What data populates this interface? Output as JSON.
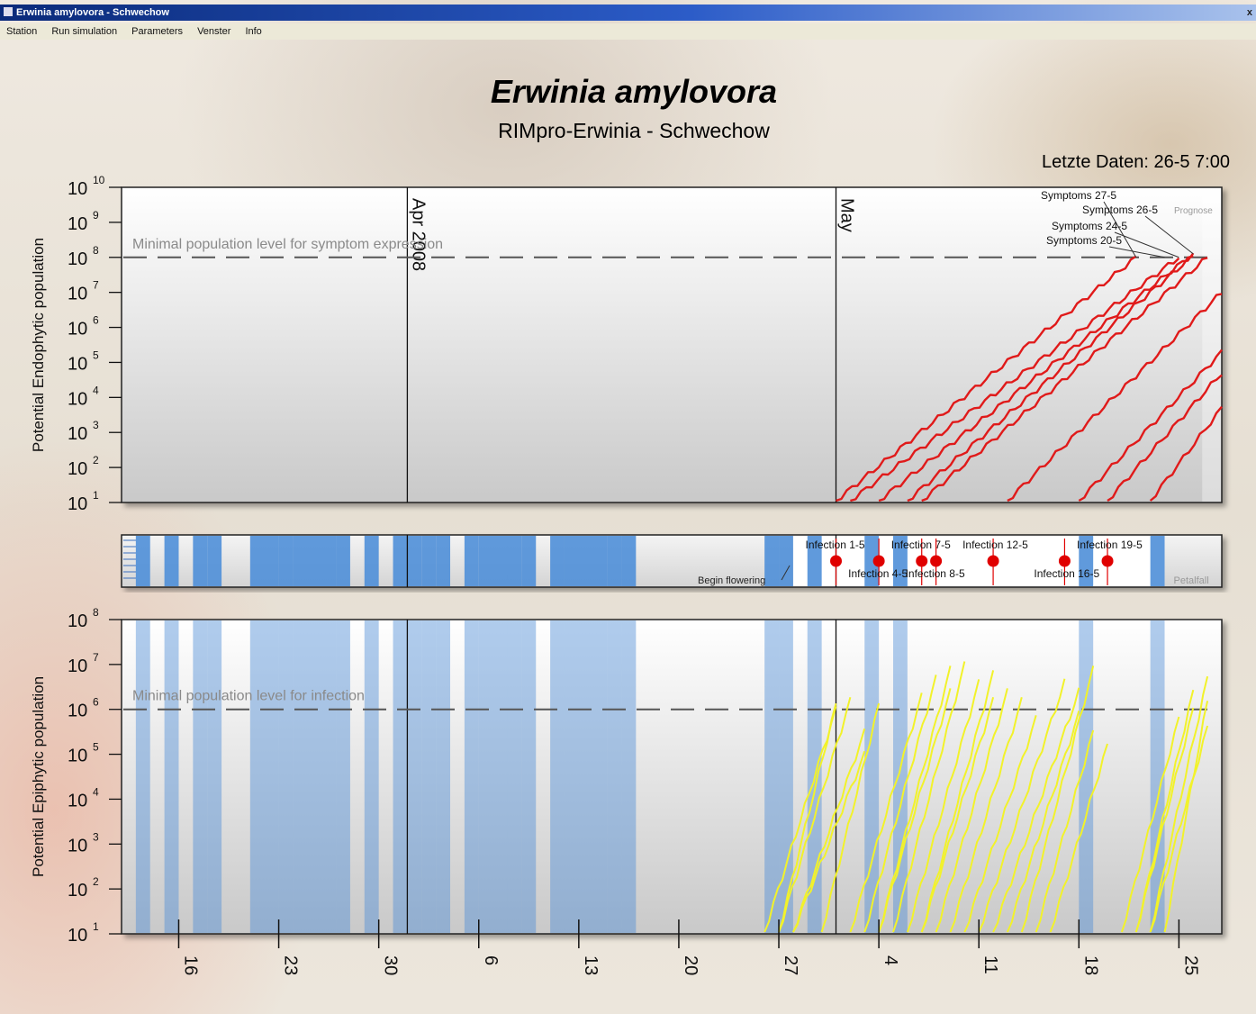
{
  "window": {
    "title": "Erwinia amylovora - Schwechow"
  },
  "menu": [
    "Station",
    "Run simulation",
    "Parameters",
    "Venster",
    "Info"
  ],
  "header": {
    "title": "Erwinia amylovora",
    "subtitle": "RIMpro-Erwinia - Schwechow",
    "last_data": "Letzte Daten: 26-5 7:00"
  },
  "colors": {
    "endophytic": "#e01a1a",
    "epiphytic": "#f2f22a",
    "wetness": "#4f8fd8",
    "infection_marker": "#e00000"
  },
  "chart_data": [
    {
      "type": "line",
      "title": "",
      "ylabel": "Potential Endophytic population",
      "yscale": "log",
      "ylim_exponent": [
        1,
        10
      ],
      "ytick_exponents": [
        1,
        2,
        3,
        4,
        5,
        6,
        7,
        8,
        9,
        10
      ],
      "x_date_range": [
        "2008-03-12",
        "2008-05-28"
      ],
      "month_labels": [
        {
          "date": "2008-04-01",
          "label": "Apr 2008"
        },
        {
          "date": "2008-05-01",
          "label": "May"
        }
      ],
      "threshold": {
        "exponent": 8,
        "label": "Minimal population level for symptom expression"
      },
      "annotations": [
        {
          "label": "Symptoms 27-5",
          "date": "2008-05-22",
          "exponent": 8
        },
        {
          "label": "Symptoms 26-5",
          "date": "2008-05-26",
          "exponent": 8.1
        },
        {
          "label": "Prognose",
          "date": "2008-05-27",
          "exponent": 8.1
        },
        {
          "label": "Symptoms 24-5",
          "date": "2008-05-25",
          "exponent": 8
        },
        {
          "label": "Symptoms 20-5",
          "date": "2008-05-24",
          "exponent": 8
        }
      ],
      "series": [
        {
          "start": "2008-05-01",
          "end": "2008-05-22",
          "y_end": 8.0
        },
        {
          "start": "2008-05-02",
          "end": "2008-05-25",
          "y_end": 8.0
        },
        {
          "start": "2008-05-04",
          "end": "2008-05-26",
          "y_end": 8.1
        },
        {
          "start": "2008-05-06",
          "end": "2008-05-26",
          "y_end": 8.05
        },
        {
          "start": "2008-05-07",
          "end": "2008-05-27",
          "y_end": 8.0
        },
        {
          "start": "2008-05-13",
          "end": "2008-05-28",
          "y_end": 7.0
        },
        {
          "start": "2008-05-18",
          "end": "2008-05-28",
          "y_end": 5.3
        },
        {
          "start": "2008-05-20",
          "end": "2008-05-28",
          "y_end": 4.7
        },
        {
          "start": "2008-05-23",
          "end": "2008-05-28",
          "y_end": 3.7
        }
      ]
    },
    {
      "type": "area",
      "title": "",
      "x_date_range": [
        "2008-03-12",
        "2008-05-28"
      ],
      "wet_periods": [
        [
          "2008-03-13",
          "2008-03-14"
        ],
        [
          "2008-03-15",
          "2008-03-16"
        ],
        [
          "2008-03-17",
          "2008-03-18"
        ],
        [
          "2008-03-18",
          "2008-03-19"
        ],
        [
          "2008-03-21",
          "2008-03-23"
        ],
        [
          "2008-03-23",
          "2008-03-24"
        ],
        [
          "2008-03-24",
          "2008-03-27"
        ],
        [
          "2008-03-27",
          "2008-03-28"
        ],
        [
          "2008-03-29",
          "2008-03-30"
        ],
        [
          "2008-03-31",
          "2008-04-01"
        ],
        [
          "2008-04-01",
          "2008-04-02"
        ],
        [
          "2008-04-02",
          "2008-04-03"
        ],
        [
          "2008-04-03",
          "2008-04-04"
        ],
        [
          "2008-04-05",
          "2008-04-06"
        ],
        [
          "2008-04-06",
          "2008-04-08"
        ],
        [
          "2008-04-08",
          "2008-04-09"
        ],
        [
          "2008-04-09",
          "2008-04-10"
        ],
        [
          "2008-04-11",
          "2008-04-12"
        ],
        [
          "2008-04-12",
          "2008-04-15"
        ],
        [
          "2008-04-15",
          "2008-04-16"
        ],
        [
          "2008-04-16",
          "2008-04-17"
        ],
        [
          "2008-04-26",
          "2008-04-27"
        ],
        [
          "2008-04-27",
          "2008-04-28"
        ],
        [
          "2008-04-29",
          "2008-04-30"
        ],
        [
          "2008-05-03",
          "2008-05-04"
        ],
        [
          "2008-05-05",
          "2008-05-06"
        ],
        [
          "2008-05-18",
          "2008-05-19"
        ],
        [
          "2008-05-23",
          "2008-05-24"
        ]
      ],
      "markers": [
        {
          "label": "Infection 1-5",
          "date": "2008-05-01"
        },
        {
          "label": "Infection 4-5",
          "date": "2008-05-04"
        },
        {
          "label": "Infection 7-5",
          "date": "2008-05-07"
        },
        {
          "label": "Infection 8-5",
          "date": "2008-05-08"
        },
        {
          "label": "Infection 12-5",
          "date": "2008-05-12"
        },
        {
          "label": "Infection 16-5",
          "date": "2008-05-17"
        },
        {
          "label": "Infection 19-5",
          "date": "2008-05-20"
        }
      ],
      "events": [
        {
          "label": "Begin flowering",
          "date": "2008-04-27"
        },
        {
          "label": "Petalfall",
          "date": "2008-05-24"
        }
      ]
    },
    {
      "type": "line",
      "title": "",
      "ylabel": "Potential Epiphytic population",
      "yscale": "log",
      "ylim_exponent": [
        1,
        8
      ],
      "ytick_exponents": [
        1,
        2,
        3,
        4,
        5,
        6,
        7,
        8
      ],
      "x_date_range": [
        "2008-03-12",
        "2008-05-28"
      ],
      "xtick_dates": [
        "2008-03-16",
        "2008-03-23",
        "2008-03-30",
        "2008-04-06",
        "2008-04-13",
        "2008-04-20",
        "2008-04-27",
        "2008-05-04",
        "2008-05-11",
        "2008-05-18",
        "2008-05-25"
      ],
      "xtick_labels": [
        "16",
        "23",
        "30",
        "6",
        "13",
        "20",
        "27",
        "4",
        "11",
        "18",
        "25"
      ],
      "threshold": {
        "exponent": 6,
        "label": "Minimal population level for infection"
      },
      "series": [
        {
          "start": "2008-04-26",
          "end": "2008-05-01",
          "y_end": 6.0
        },
        {
          "start": "2008-04-27",
          "end": "2008-05-01",
          "y_end": 6.1
        },
        {
          "start": "2008-04-27",
          "end": "2008-05-02",
          "y_end": 6.2
        },
        {
          "start": "2008-04-28",
          "end": "2008-05-03",
          "y_end": 5.5
        },
        {
          "start": "2008-04-28",
          "end": "2008-05-03",
          "y_end": 5.0
        },
        {
          "start": "2008-04-30",
          "end": "2008-05-04",
          "y_end": 6.1
        },
        {
          "start": "2008-05-02",
          "end": "2008-05-07",
          "y_end": 6.3
        },
        {
          "start": "2008-05-03",
          "end": "2008-05-08",
          "y_end": 6.7
        },
        {
          "start": "2008-05-04",
          "end": "2008-05-09",
          "y_end": 6.9
        },
        {
          "start": "2008-05-04",
          "end": "2008-05-09",
          "y_end": 6.4
        },
        {
          "start": "2008-05-05",
          "end": "2008-05-10",
          "y_end": 7.0
        },
        {
          "start": "2008-05-06",
          "end": "2008-05-11",
          "y_end": 6.6
        },
        {
          "start": "2008-05-07",
          "end": "2008-05-12",
          "y_end": 6.8
        },
        {
          "start": "2008-05-07",
          "end": "2008-05-12",
          "y_end": 6.2
        },
        {
          "start": "2008-05-08",
          "end": "2008-05-13",
          "y_end": 6.4
        },
        {
          "start": "2008-05-09",
          "end": "2008-05-14",
          "y_end": 6.2
        },
        {
          "start": "2008-05-10",
          "end": "2008-05-15",
          "y_end": 5.8
        },
        {
          "start": "2008-05-11",
          "end": "2008-05-17",
          "y_end": 6.6
        },
        {
          "start": "2008-05-12",
          "end": "2008-05-18",
          "y_end": 6.4
        },
        {
          "start": "2008-05-13",
          "end": "2008-05-18",
          "y_end": 5.9
        },
        {
          "start": "2008-05-14",
          "end": "2008-05-19",
          "y_end": 6.9
        },
        {
          "start": "2008-05-15",
          "end": "2008-05-19",
          "y_end": 5.5
        },
        {
          "start": "2008-05-16",
          "end": "2008-05-20",
          "y_end": 5.2
        },
        {
          "start": "2008-05-21",
          "end": "2008-05-25",
          "y_end": 5.8
        },
        {
          "start": "2008-05-22",
          "end": "2008-05-26",
          "y_end": 6.4
        },
        {
          "start": "2008-05-22",
          "end": "2008-05-26",
          "y_end": 6.0
        },
        {
          "start": "2008-05-23",
          "end": "2008-05-27",
          "y_end": 6.7
        },
        {
          "start": "2008-05-23",
          "end": "2008-05-27",
          "y_end": 5.6
        },
        {
          "start": "2008-05-24",
          "end": "2008-05-27",
          "y_end": 6.2
        }
      ]
    }
  ]
}
